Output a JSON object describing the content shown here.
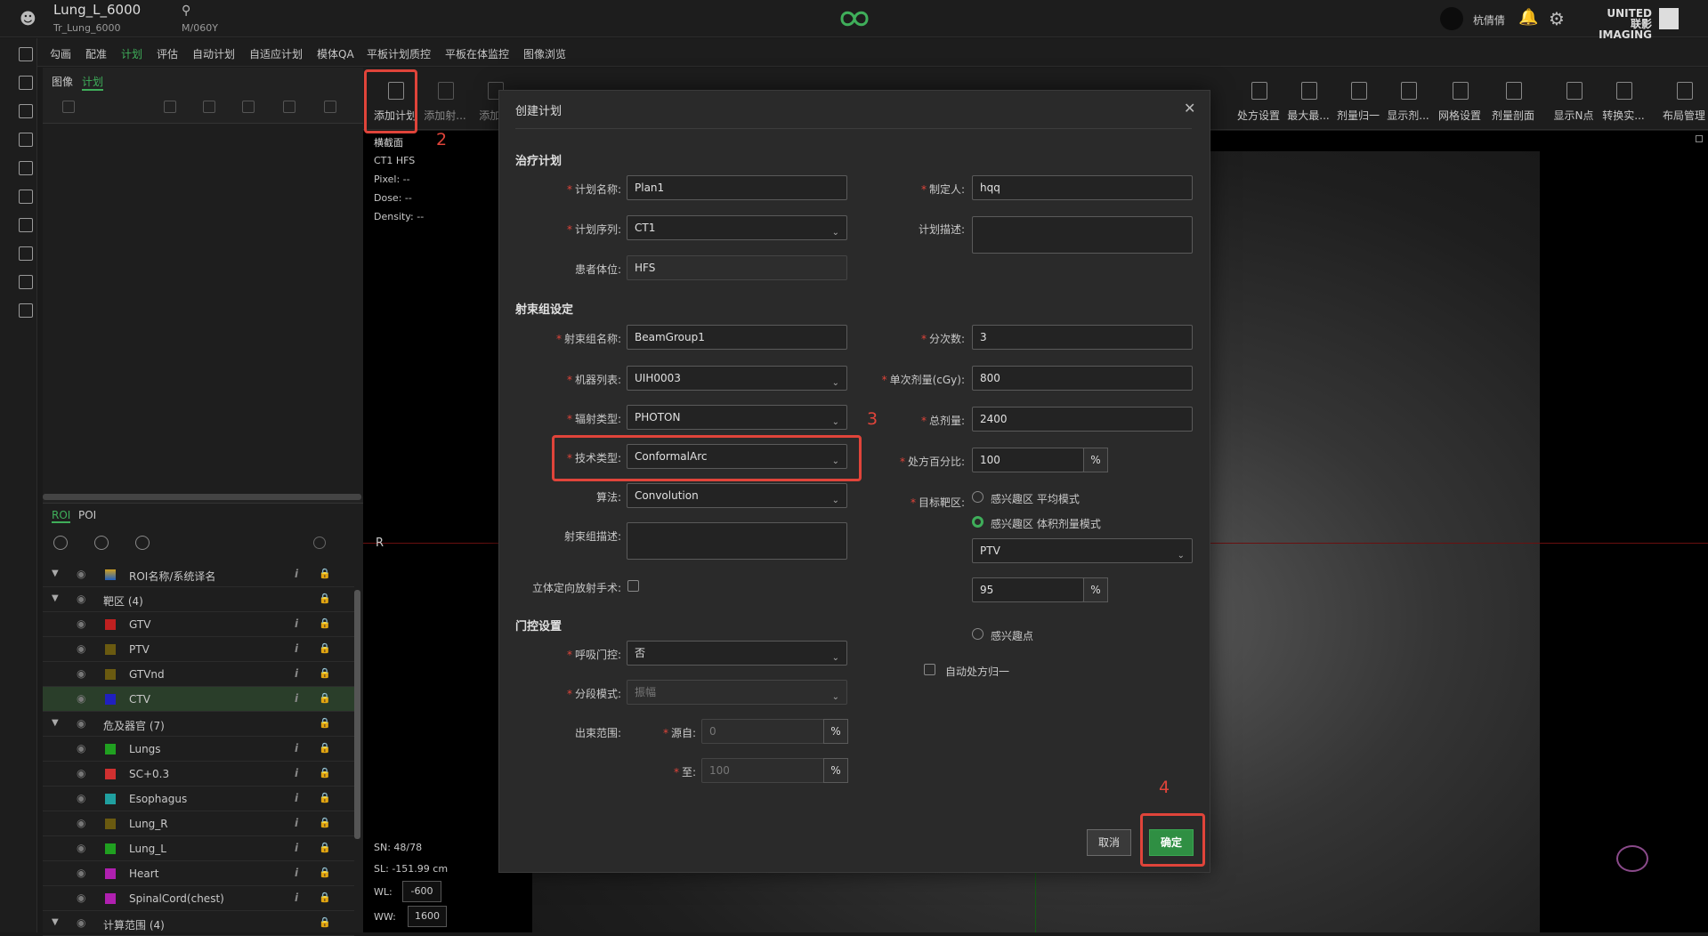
{
  "header": {
    "patient_name": "Lung_L_6000",
    "plan_code": "Tr_Lung_6000",
    "patient_meta": "M/060Y",
    "username": "杭倩倩",
    "brand_line1": "UNITED 联影",
    "brand_line2": "IMAGING"
  },
  "menu": [
    "勾画",
    "配准",
    "计划",
    "评估",
    "自动计划",
    "自适应计划",
    "模体QA",
    "平板计划质控",
    "平板在体监控",
    "图像浏览"
  ],
  "menu_active_index": 2,
  "left_tabs": {
    "image": "图像",
    "plan": "计划"
  },
  "roi_tabs": {
    "roi": "ROI",
    "poi": "POI"
  },
  "roi_header": "ROI名称/系统译名",
  "roi_rows": [
    {
      "kind": "group",
      "name": "靶区 (4)"
    },
    {
      "kind": "item",
      "name": "GTV",
      "color": "#c02020"
    },
    {
      "kind": "item",
      "name": "PTV",
      "color": "#6a5a10"
    },
    {
      "kind": "item",
      "name": "GTVnd",
      "color": "#6a5a10"
    },
    {
      "kind": "item",
      "name": "CTV",
      "color": "#2020c0",
      "selected": true
    },
    {
      "kind": "group",
      "name": "危及器官 (7)"
    },
    {
      "kind": "item",
      "name": "Lungs",
      "color": "#20a020"
    },
    {
      "kind": "item",
      "name": "SC+0.3",
      "color": "#d03030"
    },
    {
      "kind": "item",
      "name": "Esophagus",
      "color": "#20a0a0"
    },
    {
      "kind": "item",
      "name": "Lung_R",
      "color": "#6a5a10"
    },
    {
      "kind": "item",
      "name": "Lung_L",
      "color": "#20a020"
    },
    {
      "kind": "item",
      "name": "Heart",
      "color": "#b020b0"
    },
    {
      "kind": "item",
      "name": "SpinalCord(chest)",
      "color": "#b020b0"
    },
    {
      "kind": "group",
      "name": "计算范围 (4)"
    }
  ],
  "toolbar": [
    {
      "label": "添加计划",
      "icon": "add-plan-icon"
    },
    {
      "label": "添加射...",
      "icon": "add-beam-icon"
    },
    {
      "label": "添加...",
      "icon": "add-icon"
    },
    {
      "label": "处方设置",
      "icon": "prescription-icon"
    },
    {
      "label": "最大最...",
      "icon": "max-min-icon"
    },
    {
      "label": "剂量归一",
      "icon": "dose-normalize-icon"
    },
    {
      "label": "显示剂...",
      "icon": "show-dose-icon"
    },
    {
      "label": "网格设置",
      "icon": "grid-icon"
    },
    {
      "label": "剂量剖面",
      "icon": "dose-profile-icon"
    },
    {
      "label": "显示N点",
      "icon": "show-n-point-icon"
    },
    {
      "label": "转换实...",
      "icon": "convert-icon"
    },
    {
      "label": "布局管理",
      "icon": "layout-icon"
    }
  ],
  "viewer": {
    "orientation": "横截面",
    "series": "CT1 HFS",
    "pixel": "Pixel:  --",
    "dose": "Dose:  --",
    "density": "Density:  --",
    "r_marker": "R",
    "sn": "SN: 48/78",
    "sl": "SL: -151.99 cm",
    "wl_label": "WL:",
    "wl_value": "-600",
    "ww_label": "WW:",
    "ww_value": "1600"
  },
  "annotations": [
    "2",
    "3",
    "4"
  ],
  "dialog": {
    "title": "创建计划",
    "section_treatment": "治疗计划",
    "plan_name_label": "计划名称:",
    "plan_name": "Plan1",
    "creator_label": "制定人:",
    "creator": "hqq",
    "plan_series_label": "计划序列:",
    "plan_series": "CT1",
    "plan_desc_label": "计划描述:",
    "patient_pos_label": "患者体位:",
    "patient_pos": "HFS",
    "section_beam": "射束组设定",
    "beam_group_name_label": "射束组名称:",
    "beam_group_name": "BeamGroup1",
    "fractions_label": "分次数:",
    "fractions": "3",
    "machine_label": "机器列表:",
    "machine": "UIH0003",
    "dose_per_fraction_label": "单次剂量(cGy):",
    "dose_per_fraction": "800",
    "radiation_type_label": "辐射类型:",
    "radiation_type": "PHOTON",
    "total_dose_label": "总剂量:",
    "total_dose": "2400",
    "technique_label": "技术类型:",
    "technique": "ConformalArc",
    "rx_percent_label": "处方百分比:",
    "rx_percent": "100",
    "percent": "%",
    "algorithm_label": "算法:",
    "algorithm": "Convolution",
    "target_label": "目标靶区:",
    "target_opt1": "感兴趣区 平均模式",
    "target_opt2": "感兴趣区 体积剂量模式",
    "target_roi": "PTV",
    "target_volume": "95",
    "target_opt3": "感兴趣点",
    "beam_desc_label": "射束组描述:",
    "stereotactic_label": "立体定向放射手术:",
    "auto_normalize_label": "自动处方归一",
    "section_gating": "门控设置",
    "resp_gating_label": "呼吸门控:",
    "resp_gating": "否",
    "segment_mode_label": "分段模式:",
    "segment_mode": "振幅",
    "beam_range_label": "出束范围:",
    "from_label": "源自:",
    "from_value": "0",
    "to_label": "至:",
    "to_value": "100",
    "cancel": "取消",
    "ok": "确定"
  }
}
